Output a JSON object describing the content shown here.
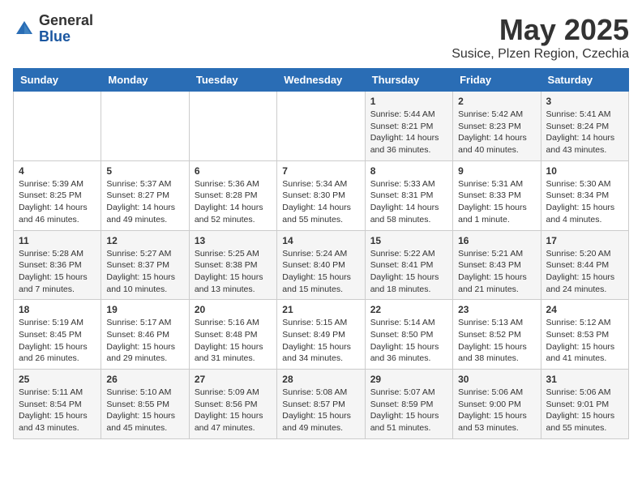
{
  "header": {
    "logo_general": "General",
    "logo_blue": "Blue",
    "month": "May 2025",
    "location": "Susice, Plzen Region, Czechia"
  },
  "days_of_week": [
    "Sunday",
    "Monday",
    "Tuesday",
    "Wednesday",
    "Thursday",
    "Friday",
    "Saturday"
  ],
  "weeks": [
    [
      {
        "day": "",
        "info": ""
      },
      {
        "day": "",
        "info": ""
      },
      {
        "day": "",
        "info": ""
      },
      {
        "day": "",
        "info": ""
      },
      {
        "day": "1",
        "info": "Sunrise: 5:44 AM\nSunset: 8:21 PM\nDaylight: 14 hours\nand 36 minutes."
      },
      {
        "day": "2",
        "info": "Sunrise: 5:42 AM\nSunset: 8:23 PM\nDaylight: 14 hours\nand 40 minutes."
      },
      {
        "day": "3",
        "info": "Sunrise: 5:41 AM\nSunset: 8:24 PM\nDaylight: 14 hours\nand 43 minutes."
      }
    ],
    [
      {
        "day": "4",
        "info": "Sunrise: 5:39 AM\nSunset: 8:25 PM\nDaylight: 14 hours\nand 46 minutes."
      },
      {
        "day": "5",
        "info": "Sunrise: 5:37 AM\nSunset: 8:27 PM\nDaylight: 14 hours\nand 49 minutes."
      },
      {
        "day": "6",
        "info": "Sunrise: 5:36 AM\nSunset: 8:28 PM\nDaylight: 14 hours\nand 52 minutes."
      },
      {
        "day": "7",
        "info": "Sunrise: 5:34 AM\nSunset: 8:30 PM\nDaylight: 14 hours\nand 55 minutes."
      },
      {
        "day": "8",
        "info": "Sunrise: 5:33 AM\nSunset: 8:31 PM\nDaylight: 14 hours\nand 58 minutes."
      },
      {
        "day": "9",
        "info": "Sunrise: 5:31 AM\nSunset: 8:33 PM\nDaylight: 15 hours\nand 1 minute."
      },
      {
        "day": "10",
        "info": "Sunrise: 5:30 AM\nSunset: 8:34 PM\nDaylight: 15 hours\nand 4 minutes."
      }
    ],
    [
      {
        "day": "11",
        "info": "Sunrise: 5:28 AM\nSunset: 8:36 PM\nDaylight: 15 hours\nand 7 minutes."
      },
      {
        "day": "12",
        "info": "Sunrise: 5:27 AM\nSunset: 8:37 PM\nDaylight: 15 hours\nand 10 minutes."
      },
      {
        "day": "13",
        "info": "Sunrise: 5:25 AM\nSunset: 8:38 PM\nDaylight: 15 hours\nand 13 minutes."
      },
      {
        "day": "14",
        "info": "Sunrise: 5:24 AM\nSunset: 8:40 PM\nDaylight: 15 hours\nand 15 minutes."
      },
      {
        "day": "15",
        "info": "Sunrise: 5:22 AM\nSunset: 8:41 PM\nDaylight: 15 hours\nand 18 minutes."
      },
      {
        "day": "16",
        "info": "Sunrise: 5:21 AM\nSunset: 8:43 PM\nDaylight: 15 hours\nand 21 minutes."
      },
      {
        "day": "17",
        "info": "Sunrise: 5:20 AM\nSunset: 8:44 PM\nDaylight: 15 hours\nand 24 minutes."
      }
    ],
    [
      {
        "day": "18",
        "info": "Sunrise: 5:19 AM\nSunset: 8:45 PM\nDaylight: 15 hours\nand 26 minutes."
      },
      {
        "day": "19",
        "info": "Sunrise: 5:17 AM\nSunset: 8:46 PM\nDaylight: 15 hours\nand 29 minutes."
      },
      {
        "day": "20",
        "info": "Sunrise: 5:16 AM\nSunset: 8:48 PM\nDaylight: 15 hours\nand 31 minutes."
      },
      {
        "day": "21",
        "info": "Sunrise: 5:15 AM\nSunset: 8:49 PM\nDaylight: 15 hours\nand 34 minutes."
      },
      {
        "day": "22",
        "info": "Sunrise: 5:14 AM\nSunset: 8:50 PM\nDaylight: 15 hours\nand 36 minutes."
      },
      {
        "day": "23",
        "info": "Sunrise: 5:13 AM\nSunset: 8:52 PM\nDaylight: 15 hours\nand 38 minutes."
      },
      {
        "day": "24",
        "info": "Sunrise: 5:12 AM\nSunset: 8:53 PM\nDaylight: 15 hours\nand 41 minutes."
      }
    ],
    [
      {
        "day": "25",
        "info": "Sunrise: 5:11 AM\nSunset: 8:54 PM\nDaylight: 15 hours\nand 43 minutes."
      },
      {
        "day": "26",
        "info": "Sunrise: 5:10 AM\nSunset: 8:55 PM\nDaylight: 15 hours\nand 45 minutes."
      },
      {
        "day": "27",
        "info": "Sunrise: 5:09 AM\nSunset: 8:56 PM\nDaylight: 15 hours\nand 47 minutes."
      },
      {
        "day": "28",
        "info": "Sunrise: 5:08 AM\nSunset: 8:57 PM\nDaylight: 15 hours\nand 49 minutes."
      },
      {
        "day": "29",
        "info": "Sunrise: 5:07 AM\nSunset: 8:59 PM\nDaylight: 15 hours\nand 51 minutes."
      },
      {
        "day": "30",
        "info": "Sunrise: 5:06 AM\nSunset: 9:00 PM\nDaylight: 15 hours\nand 53 minutes."
      },
      {
        "day": "31",
        "info": "Sunrise: 5:06 AM\nSunset: 9:01 PM\nDaylight: 15 hours\nand 55 minutes."
      }
    ]
  ]
}
